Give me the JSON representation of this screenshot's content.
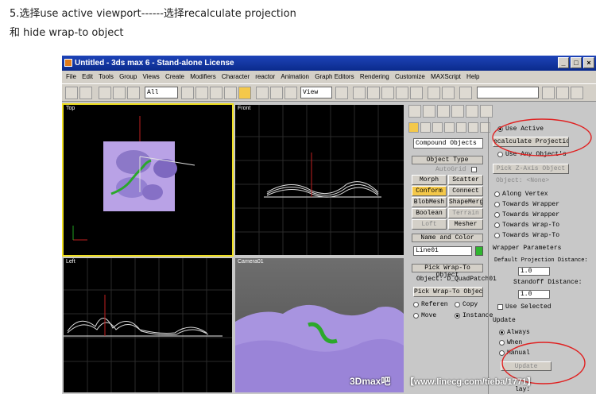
{
  "caption": {
    "line1": "5.选择use active viewport------选择recalculate projection",
    "line2": "和 hide wrap-to object"
  },
  "window": {
    "title": "Untitled - 3ds max 6 - Stand-alone License",
    "controls": [
      "_",
      "□",
      "×"
    ]
  },
  "menu": [
    "File",
    "Edit",
    "Tools",
    "Group",
    "Views",
    "Create",
    "Modifiers",
    "Character",
    "reactor",
    "Animation",
    "Graph Editors",
    "Rendering",
    "Customize",
    "MAXScript",
    "Help"
  ],
  "toolbar": {
    "filter": "All",
    "refcoord": "View"
  },
  "viewports": {
    "top": "Top",
    "front": "Front",
    "left": "Left",
    "camera": "Camera01"
  },
  "create_panel": {
    "category": "Compound Objects",
    "object_type_header": "Object Type",
    "autogrid": "AutoGrid",
    "buttons": [
      "Morph",
      "Scatter",
      "Conform",
      "Connect",
      "BlobMesh",
      "ShapeMerge",
      "Boolean",
      "Terrain",
      "Loft",
      "Mesher"
    ],
    "name_color_header": "Name and Color",
    "name_value": "Line01",
    "name_color": "#2fb52f",
    "pick_header": "Pick Wrap-To Object",
    "pick_object": "Object: D_QuadPatch01",
    "pick_button": "Pick Wrap-To Object",
    "reference": "Referen",
    "copy": "Copy",
    "move": "Move",
    "instance": "Instance"
  },
  "params": {
    "use_active": "Use Active",
    "recalc": "ecalculate Projectio",
    "use_any": "Use Any Object's",
    "pick_z": "Pick Z-Axis Object",
    "object_none": "Object: <None>",
    "along_vertex": "Along Vertex",
    "towards1": "Towards Wrapper",
    "towards2": "Towards Wrapper",
    "towards3": "Towards Wrap-To",
    "towards4": "Towards Wrap-To",
    "wrapper_header": "Wrapper Parameters",
    "default_proj": "Default Projection Distance:",
    "default_proj_val": "1.0",
    "standoff": "Standoff Distance:",
    "standoff_val": "1.0",
    "use_selected": "Use Selected",
    "update_header": "Update",
    "always": "Always",
    "when": "When",
    "manual": "Manual",
    "update_btn": "Update",
    "display": "lay:"
  },
  "watermark": {
    "left": "3Dmax吧",
    "right": "【www.linecg.com/tieba/1771】"
  }
}
